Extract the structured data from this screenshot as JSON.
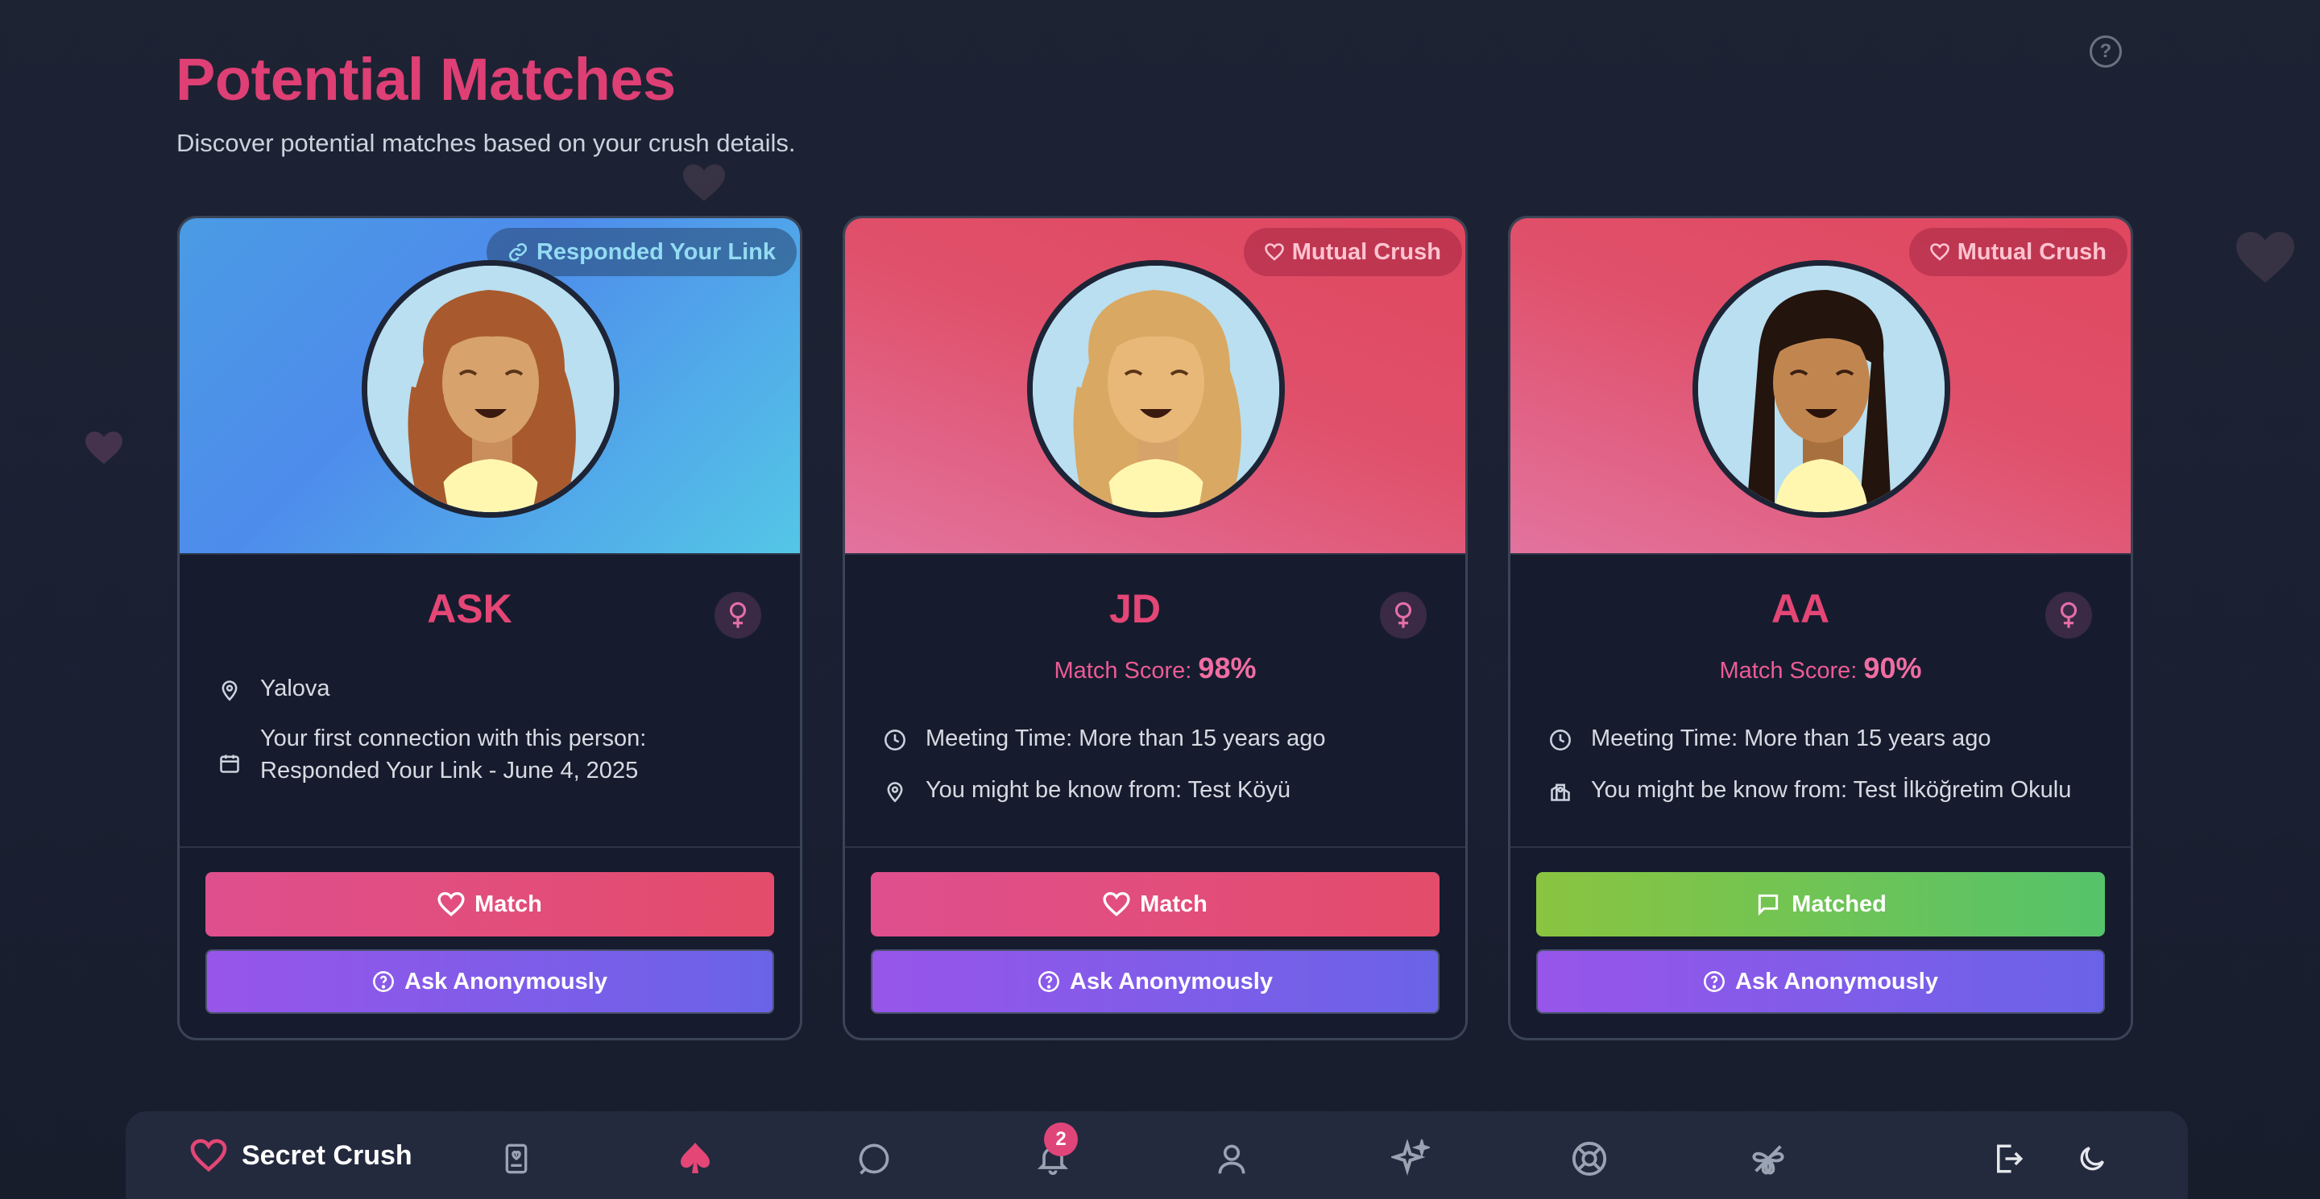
{
  "header": {
    "title": "Potential Matches",
    "subtitle": "Discover potential matches based on your crush details."
  },
  "cards": [
    {
      "initials": "ASK",
      "badge": "Responded Your Link",
      "badge_icon": "link-icon",
      "gender_icon": "female-icon",
      "info": [
        {
          "icon": "map-pin-icon",
          "text": "Yalova"
        },
        {
          "icon": "calendar-icon",
          "line1": "Your first connection with this person:",
          "line2": "Responded Your Link - June 4, 2025"
        }
      ],
      "primary_button": "Match",
      "secondary_button": "Ask Anonymously"
    },
    {
      "initials": "JD",
      "badge": "Mutual Crush",
      "badge_icon": "heart-icon",
      "gender_icon": "female-icon",
      "score_label": "Match Score:",
      "score_value": "98%",
      "info": [
        {
          "icon": "clock-icon",
          "text": "Meeting Time: More than 15 years ago"
        },
        {
          "icon": "map-pin-icon",
          "text": "You might be know from: Test Köyü"
        }
      ],
      "primary_button": "Match",
      "secondary_button": "Ask Anonymously"
    },
    {
      "initials": "AA",
      "badge": "Mutual Crush",
      "badge_icon": "heart-icon",
      "gender_icon": "female-icon",
      "score_label": "Match Score:",
      "score_value": "90%",
      "info": [
        {
          "icon": "clock-icon",
          "text": "Meeting Time: More than 15 years ago"
        },
        {
          "icon": "school-icon",
          "text": "You might be know from: Test İlköğretim Okulu"
        }
      ],
      "primary_button": "Matched",
      "secondary_button": "Ask Anonymously"
    }
  ],
  "nav": {
    "brand": "Secret Crush",
    "notification_count": "2",
    "items": [
      "book-icon",
      "spade-icon",
      "chat-icon",
      "bell-icon",
      "user-icon",
      "sparkles-icon",
      "lifebuoy-icon",
      "clover-icon",
      "logout-icon",
      "moon-icon"
    ]
  },
  "colors": {
    "accent": "#de3f74",
    "match_gradient": [
      "#df4f8e",
      "#e44c6b"
    ],
    "matched_gradient": [
      "#8ac440",
      "#55c36a"
    ],
    "ask_gradient": [
      "#9855ea",
      "#6a63e8"
    ]
  }
}
